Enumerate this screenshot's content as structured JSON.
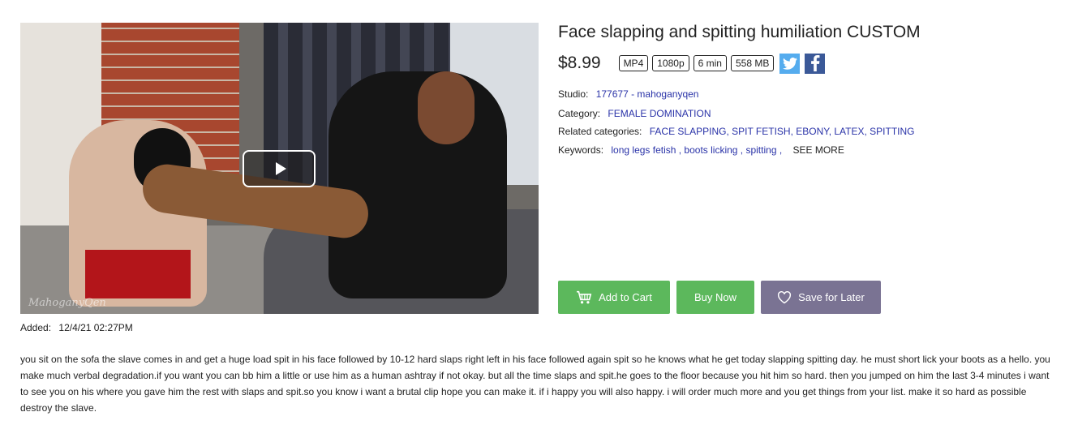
{
  "product": {
    "title": "Face slapping and spitting humiliation CUSTOM",
    "price": "$8.99",
    "tags": [
      "MP4",
      "1080p",
      "6 min",
      "558 MB"
    ],
    "watermark": "MahoganyQen"
  },
  "meta": {
    "studio_label": "Studio:",
    "studio_value": "177677 - mahoganyqen",
    "category_label": "Category:",
    "category_value": "FEMALE DOMINATION",
    "related_label": "Related categories:",
    "related_value": "FACE SLAPPING, SPIT FETISH, EBONY, LATEX, SPITTING",
    "keywords_label": "Keywords:",
    "keywords_value": "long legs fetish , boots licking , spitting ,",
    "see_more": "SEE MORE"
  },
  "buttons": {
    "add_to_cart": "Add to Cart",
    "buy_now": "Buy Now",
    "save_for_later": "Save for Later"
  },
  "added": {
    "label": "Added:",
    "value": "12/4/21 02:27PM"
  },
  "description": "you sit on the sofa the slave comes in and get a huge load spit in his face followed by 10-12 hard slaps right left in his face followed again spit so he knows what he get today slapping spitting day. he must short lick your boots as a hello.  you make much verbal degradation.if you want you can bb him a little or use him as a human ashtray if not okay. but all the time slaps and spit.he goes to the floor because you hit him so hard. then you jumped on him the last 3-4 minutes i want to see you on his where you gave him the rest with slaps and spit.so you know i want a brutal clip hope you can make it. if i happy you will also happy. i will order much more and you get things from your list. make it so hard as possible destroy the slave.",
  "colors": {
    "green_button": "#5cb85c",
    "save_button": "#7a7393",
    "link": "#2a33a8",
    "twitter": "#55acee",
    "facebook": "#3b5998"
  },
  "icons": [
    "play-icon",
    "twitter-icon",
    "facebook-icon",
    "cart-icon",
    "heart-icon"
  ]
}
